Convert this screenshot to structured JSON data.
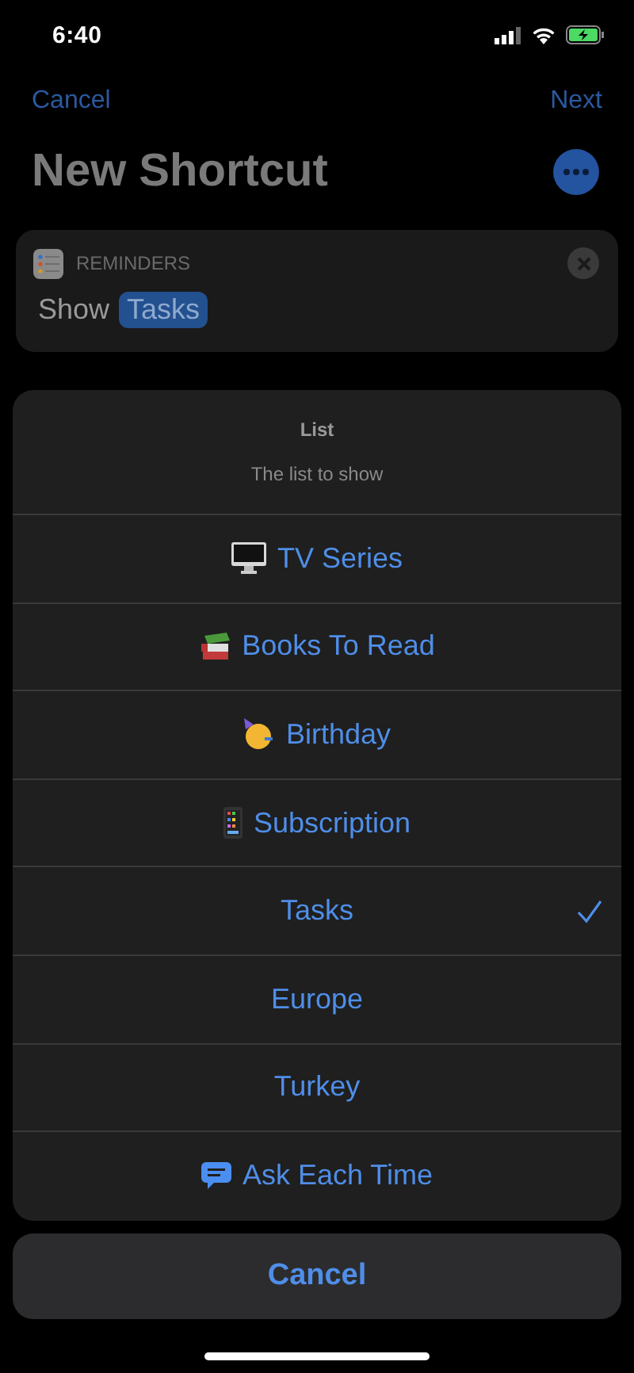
{
  "status_bar": {
    "time": "6:40"
  },
  "nav": {
    "left": "Cancel",
    "right": "Next"
  },
  "title": "New Shortcut",
  "action": {
    "app": "REMINDERS",
    "verb": "Show",
    "parameter": "Tasks"
  },
  "sheet": {
    "title": "List",
    "subtitle": "The list to show",
    "options": [
      {
        "label": "TV Series",
        "selected": false
      },
      {
        "label": "Books To Read",
        "selected": false
      },
      {
        "label": "Birthday",
        "selected": false
      },
      {
        "label": "Subscription",
        "selected": false
      },
      {
        "label": "Tasks",
        "selected": true
      },
      {
        "label": "Europe",
        "selected": false
      },
      {
        "label": "Turkey",
        "selected": false
      },
      {
        "label": "Ask Each Time",
        "selected": false
      }
    ]
  },
  "cancel": "Cancel"
}
